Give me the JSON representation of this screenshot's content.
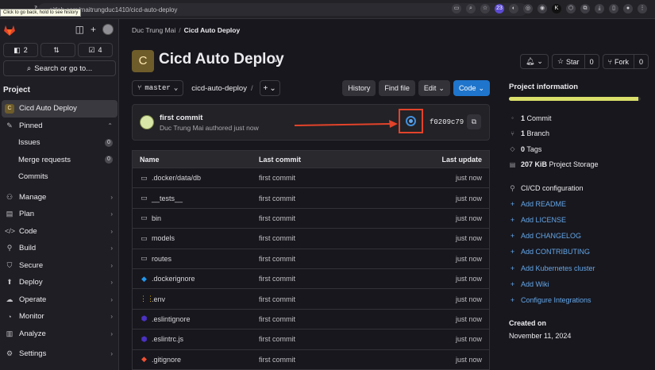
{
  "browser": {
    "url": "gitlab.com/maitrungduc1410/cicd-auto-deploy",
    "tooltip": "Click to go back, hold to see history",
    "ext_badge": "23",
    "ext_k": "K"
  },
  "sidebar": {
    "issues_count": "2",
    "mr_count": "",
    "todo_count": "4",
    "search_label": "Search or go to...",
    "section_label": "Project",
    "project_initial": "C",
    "project_name": "Cicd Auto Deploy",
    "pinned_label": "Pinned",
    "pinned": [
      {
        "label": "Issues",
        "badge": "0"
      },
      {
        "label": "Merge requests",
        "badge": "0"
      },
      {
        "label": "Commits",
        "badge": ""
      }
    ],
    "groups": [
      "Manage",
      "Plan",
      "Code",
      "Build",
      "Secure",
      "Deploy",
      "Operate",
      "Monitor",
      "Analyze"
    ],
    "settings_label": "Settings"
  },
  "breadcrumb": {
    "owner": "Duc Trung Mai",
    "project": "Cicd Auto Deploy"
  },
  "header": {
    "initial": "C",
    "title": "Cicd Auto Deploy",
    "star_label": "Star",
    "star_count": "0",
    "fork_label": "Fork",
    "fork_count": "0"
  },
  "repo_bar": {
    "branch": "master",
    "path": "cicd-auto-deploy",
    "path_sep": "/",
    "add_label": "+",
    "history": "History",
    "find_file": "Find file",
    "edit": "Edit",
    "code": "Code"
  },
  "commit": {
    "title": "first commit",
    "meta": "Duc Trung Mai authored just now",
    "sha": "f0209c79"
  },
  "table": {
    "headers": {
      "name": "Name",
      "last_commit": "Last commit",
      "last_update": "Last update"
    },
    "rows": [
      {
        "name": ".docker/data/db",
        "icon": "folder-icon",
        "commit": "first commit",
        "update": "just now"
      },
      {
        "name": "__tests__",
        "icon": "folder-icon",
        "commit": "first commit",
        "update": "just now"
      },
      {
        "name": "bin",
        "icon": "folder-icon",
        "commit": "first commit",
        "update": "just now"
      },
      {
        "name": "models",
        "icon": "folder-icon",
        "commit": "first commit",
        "update": "just now"
      },
      {
        "name": "routes",
        "icon": "folder-icon",
        "commit": "first commit",
        "update": "just now"
      },
      {
        "name": ".dockerignore",
        "icon": "docker-icon",
        "commit": "first commit",
        "update": "just now"
      },
      {
        "name": ".env",
        "icon": "env-icon",
        "commit": "first commit",
        "update": "just now"
      },
      {
        "name": ".eslintignore",
        "icon": "eslint-icon",
        "commit": "first commit",
        "update": "just now"
      },
      {
        "name": ".eslintrc.js",
        "icon": "eslint-icon",
        "commit": "first commit",
        "update": "just now"
      },
      {
        "name": ".gitignore",
        "icon": "git-icon",
        "commit": "first commit",
        "update": "just now"
      }
    ]
  },
  "info": {
    "title": "Project information",
    "storage_fill_pct": 98,
    "stats": [
      {
        "value": "1",
        "label": " Commit"
      },
      {
        "value": "1",
        "label": " Branch"
      },
      {
        "value": "0",
        "label": " Tags"
      },
      {
        "value": "207 KiB",
        "label": " Project Storage"
      }
    ],
    "links": [
      {
        "label": "CI/CD configuration",
        "plain": true
      },
      {
        "label": "Add README",
        "plain": false
      },
      {
        "label": "Add LICENSE",
        "plain": false
      },
      {
        "label": "Add CHANGELOG",
        "plain": false
      },
      {
        "label": "Add CONTRIBUTING",
        "plain": false
      },
      {
        "label": "Add Kubernetes cluster",
        "plain": false
      },
      {
        "label": "Add Wiki",
        "plain": false
      },
      {
        "label": "Configure Integrations",
        "plain": false
      }
    ],
    "created_label": "Created on",
    "created_value": "November 11, 2024"
  },
  "colors": {
    "accent": "#1f75cb",
    "link": "#63a6e9",
    "highlight_box": "#e2432a",
    "storage_bar": "#d9df6a"
  }
}
